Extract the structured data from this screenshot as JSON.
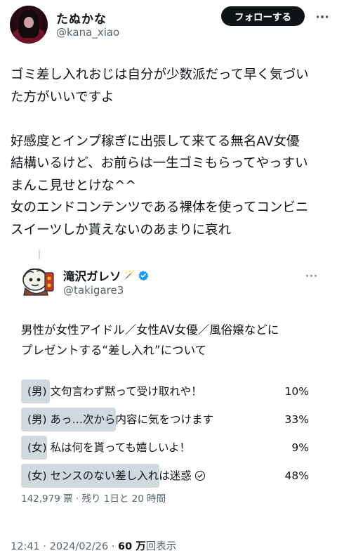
{
  "author": {
    "display_name": "たぬかな",
    "handle": "@kana_xiao",
    "follow_label": "フォローする"
  },
  "tweet": {
    "lines": [
      "ゴミ差し入れおじは自分が少数派だって早く気づい",
      "た方がいいですよ",
      "",
      "好感度とインプ稼ぎに出張して来てる無名AV女優",
      "結構いるけど、お前らは一生ゴミもらってやっすい",
      "まんこ見せとけな^^",
      "女のエンドコンテンツである裸体を使ってコンビニ",
      "スイーツしか貰えないのあまりに哀れ"
    ]
  },
  "quoted": {
    "display_name": "滝沢ガレソ",
    "name_emoji": "🪄",
    "handle": "@takigare3",
    "question_lines": [
      "男性が女性アイドル／女性AV女優／風俗嬢などに",
      "プレゼントする“差し入れ”について"
    ],
    "poll": {
      "options": [
        {
          "label": "(男) 文句言わず黙って受け取れや！",
          "percent": "10%",
          "value": 10,
          "winner": false
        },
        {
          "label": "(男) あっ…次から内容に気をつけます",
          "percent": "33%",
          "value": 33,
          "winner": false
        },
        {
          "label": "(女) 私は何を貰っても嬉しいよ！",
          "percent": "9%",
          "value": 9,
          "winner": false
        },
        {
          "label": "(女) センスのない差し入れは迷惑",
          "percent": "48%",
          "value": 48,
          "winner": true
        }
      ],
      "meta": "142,979 票 · 残り 1日と 20 時間"
    }
  },
  "footer": {
    "time": "12:41",
    "date": "2024/02/26",
    "views_count": "60 万",
    "views_label": "回表示"
  },
  "colors": {
    "text": "#0f1419",
    "secondary": "#536471",
    "poll_bar": "#cfd9de",
    "verified": "#1d9bf0",
    "follow_bg": "#0f1419"
  }
}
